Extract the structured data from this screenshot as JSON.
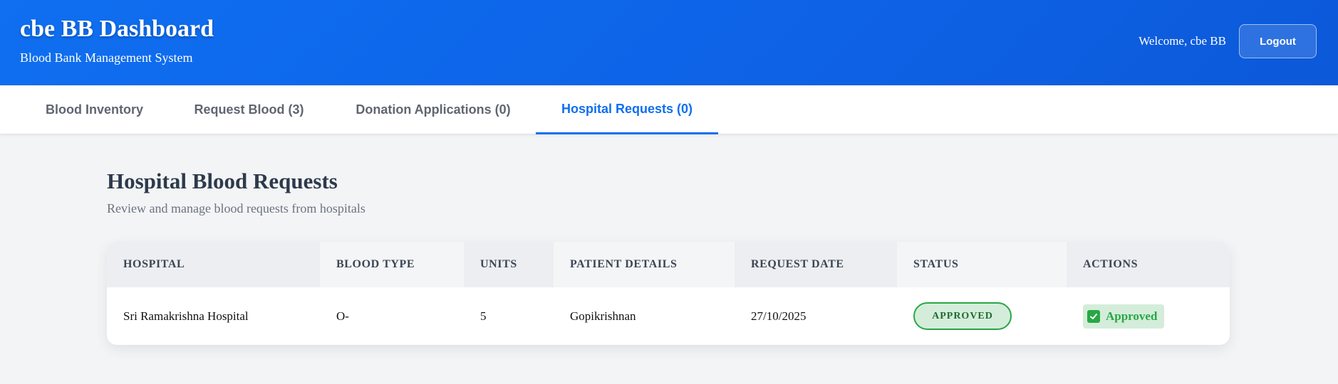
{
  "header": {
    "title": "cbe BB Dashboard",
    "subtitle": "Blood Bank Management System",
    "welcome": "Welcome, cbe BB",
    "logout_label": "Logout",
    "accent": "#0f6ff0"
  },
  "tabs": [
    {
      "label": "Blood Inventory",
      "active": false
    },
    {
      "label": "Request Blood (3)",
      "active": false
    },
    {
      "label": "Donation Applications (0)",
      "active": false
    },
    {
      "label": "Hospital Requests (0)",
      "active": true
    }
  ],
  "main": {
    "title": "Hospital Blood Requests",
    "subtitle": "Review and manage blood requests from hospitals"
  },
  "table": {
    "columns": [
      "HOSPITAL",
      "BLOOD TYPE",
      "UNITS",
      "PATIENT DETAILS",
      "REQUEST DATE",
      "STATUS",
      "ACTIONS"
    ],
    "rows": [
      {
        "hospital": "Sri Ramakrishna Hospital",
        "blood_type": "O-",
        "units": "5",
        "patient": "Gopikrishnan",
        "date": "27/10/2025",
        "status": "APPROVED",
        "action": "Approved",
        "action_icon": "check-icon"
      }
    ]
  },
  "colors": {
    "status_green": "#28a745",
    "status_bg": "#d4edda"
  }
}
